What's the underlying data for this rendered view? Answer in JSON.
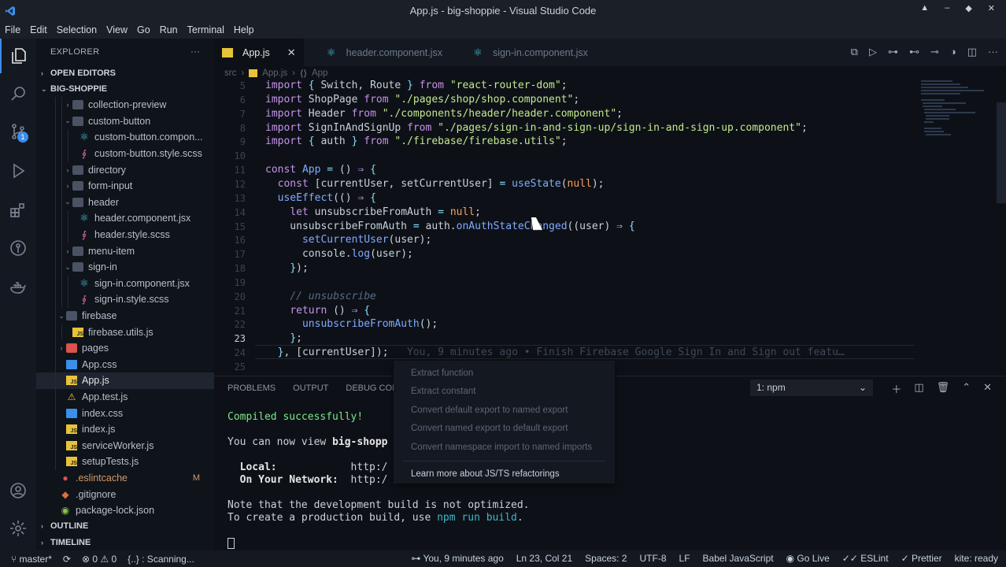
{
  "window": {
    "title": "App.js - big-shoppie - Visual Studio Code"
  },
  "menu": [
    "File",
    "Edit",
    "Selection",
    "View",
    "Go",
    "Run",
    "Terminal",
    "Help"
  ],
  "activity": {
    "scm_badge": "1"
  },
  "sidebar": {
    "title": "EXPLORER",
    "more": "···",
    "open_editors": "OPEN EDITORS",
    "project": "BIG-SHOPPIE",
    "outline": "OUTLINE",
    "timeline": "TIMELINE",
    "tree": [
      {
        "label": "collection-preview",
        "type": "folder",
        "indent": 2,
        "chev": "›"
      },
      {
        "label": "custom-button",
        "type": "folder",
        "indent": 2,
        "chev": "⌄"
      },
      {
        "label": "custom-button.compon...",
        "type": "react",
        "indent": 3
      },
      {
        "label": "custom-button.style.scss",
        "type": "scss",
        "indent": 3
      },
      {
        "label": "directory",
        "type": "folder",
        "indent": 2,
        "chev": "›"
      },
      {
        "label": "form-input",
        "type": "folder",
        "indent": 2,
        "chev": "›"
      },
      {
        "label": "header",
        "type": "folder",
        "indent": 2,
        "chev": "⌄"
      },
      {
        "label": "header.component.jsx",
        "type": "react",
        "indent": 3
      },
      {
        "label": "header.style.scss",
        "type": "scss",
        "indent": 3
      },
      {
        "label": "menu-item",
        "type": "folder",
        "indent": 2,
        "chev": "›"
      },
      {
        "label": "sign-in",
        "type": "folder",
        "indent": 2,
        "chev": "⌄"
      },
      {
        "label": "sign-in.component.jsx",
        "type": "react",
        "indent": 3
      },
      {
        "label": "sign-in.style.scss",
        "type": "scss",
        "indent": 3
      },
      {
        "label": "firebase",
        "type": "folder",
        "indent": 1,
        "chev": "⌄"
      },
      {
        "label": "firebase.utils.js",
        "type": "js",
        "indent": 2
      },
      {
        "label": "pages",
        "type": "folder-red",
        "indent": 1,
        "chev": "›"
      },
      {
        "label": "App.css",
        "type": "css",
        "indent": 1
      },
      {
        "label": "App.js",
        "type": "js",
        "indent": 1,
        "selected": true
      },
      {
        "label": "App.test.js",
        "type": "test",
        "indent": 1
      },
      {
        "label": "index.css",
        "type": "css",
        "indent": 1
      },
      {
        "label": "index.js",
        "type": "js",
        "indent": 1
      },
      {
        "label": "serviceWorker.js",
        "type": "js",
        "indent": 1
      },
      {
        "label": "setupTests.js",
        "type": "js",
        "indent": 1
      },
      {
        "label": ".eslintcache",
        "type": "dot",
        "indent": 0,
        "modified": "M"
      },
      {
        "label": ".gitignore",
        "type": "git",
        "indent": 0
      },
      {
        "label": "package-lock.json",
        "type": "npm",
        "indent": 0
      }
    ]
  },
  "tabs": [
    {
      "label": "App.js",
      "active": true,
      "close": "✕"
    },
    {
      "label": "header.component.jsx",
      "active": false
    },
    {
      "label": "sign-in.component.jsx",
      "active": false
    }
  ],
  "breadcrumb": {
    "folder": "src",
    "sep": "›",
    "file": "App.js",
    "symbol": "App"
  },
  "code_lines": [
    {
      "n": "5",
      "html": "<span class='k'>import</span> <span class='p'>{</span> Switch, Route <span class='p'>}</span> <span class='k'>from</span> <span class='s'>\"react-router-dom\"</span>;"
    },
    {
      "n": "6",
      "html": "<span class='k'>import</span> ShopPage <span class='k'>from</span> <span class='s'>\"./pages/shop/shop.component\"</span>;"
    },
    {
      "n": "7",
      "html": "<span class='k'>import</span> Header <span class='k'>from</span> <span class='s'>\"./components/header/header.component\"</span>;"
    },
    {
      "n": "8",
      "html": "<span class='k'>import</span> SignInAndSignUp <span class='k'>from</span> <span class='s'>\"./pages/sign-in-and-sign-up/sign-in-and-sign-up.component\"</span>;"
    },
    {
      "n": "9",
      "html": "<span class='k'>import</span> <span class='p'>{</span> auth <span class='p'>}</span> <span class='k'>from</span> <span class='s'>\"./firebase/firebase.utils\"</span>;"
    },
    {
      "n": "10",
      "html": ""
    },
    {
      "n": "11",
      "html": "<span class='k'>const</span> <span class='f'>App</span> <span class='p'>=</span> () <span class='k'>⇒</span> <span class='p'>{</span>"
    },
    {
      "n": "12",
      "html": "  <span class='k'>const</span> [currentUser, setCurrentUser] <span class='p'>=</span> <span class='f'>useState</span>(<span class='n'>null</span>);"
    },
    {
      "n": "13",
      "html": "  <span class='f'>useEffect</span>(() <span class='k'>⇒</span> <span class='p'>{</span>"
    },
    {
      "n": "14",
      "html": "    <span class='k'>let</span> unsubscribeFromAuth <span class='p'>=</span> <span class='n'>null</span>;"
    },
    {
      "n": "15",
      "html": "    unsubscribeFromAuth <span class='p'>=</span> auth.<span class='f'>onAuthStateChanged</span>((user) <span class='k'>⇒</span> <span class='p'>{</span>"
    },
    {
      "n": "16",
      "html": "      <span class='f'>setCurrentUser</span>(user);"
    },
    {
      "n": "17",
      "html": "      console.<span class='f'>log</span>(user);"
    },
    {
      "n": "18",
      "html": "    <span class='p'>}</span>);"
    },
    {
      "n": "19",
      "html": ""
    },
    {
      "n": "20",
      "html": "    <span class='c'>// unsubscribe</span>"
    },
    {
      "n": "21",
      "html": "    <span class='k'>return</span> () <span class='k'>⇒</span> <span class='p'>{</span>"
    },
    {
      "n": "22",
      "html": "      <span class='f'>unsubscribeFromAuth</span>();"
    },
    {
      "n": "23",
      "html": "    <span class='p'>}</span>;"
    },
    {
      "n": "24",
      "html": "  <span class='p'>}</span>, [currentUser]);   <span class='blame'>You, 9 minutes ago • Finish Firebase Google Sign In and Sign out featu…</span>"
    },
    {
      "n": "25",
      "html": ""
    }
  ],
  "panel": {
    "tabs": [
      "PROBLEMS",
      "OUTPUT",
      "DEBUG CONSOLE"
    ],
    "terminal_select": "1: npm",
    "terminal": {
      "l1": "Compiled successfully!",
      "l2a": "You can now view ",
      "l2b": "big-shopp",
      "l3a": "  Local:",
      "l3b": "http:/",
      "l4a": "  On Your Network:",
      "l4b": "http:/",
      "l5": "Note that the development build is not optimized.",
      "l6a": "To create a production build, use ",
      "l6b": "npm run build",
      "l6c": "."
    }
  },
  "context_menu": {
    "items": [
      "Extract function",
      "Extract constant",
      "Convert default export to named export",
      "Convert named export to default export",
      "Convert namespace import to named imports"
    ],
    "learn": "Learn more about JS/TS refactorings"
  },
  "status": {
    "branch": "master*",
    "problems": "⊗ 0 ⚠ 0",
    "scanning": "{..} : Scanning...",
    "blame": "You, 9 minutes ago",
    "position": "Ln 23, Col 21",
    "spaces": "Spaces: 2",
    "encoding": "UTF-8",
    "eol": "LF",
    "language": "Babel JavaScript",
    "golive": "Go Live",
    "eslint": "ESLint",
    "prettier": "Prettier",
    "kite": "kite: ready"
  }
}
